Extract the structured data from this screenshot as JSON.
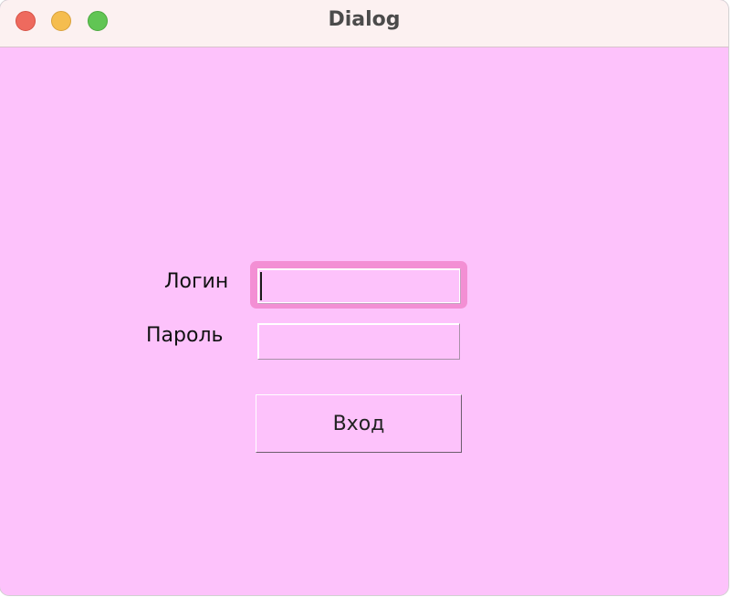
{
  "window": {
    "title": "Dialog",
    "background": "#fdc2fb",
    "titlebar_background": "#fcf1f1",
    "focus_ring_color": "#f38fd4"
  },
  "traffic_lights": {
    "close": "#ee6a5e",
    "minimize": "#f5bd4f",
    "zoom": "#61c554"
  },
  "form": {
    "login_label": "Логин",
    "login_value": "",
    "password_label": "Пароль",
    "password_value": "",
    "submit_label": "Вход"
  }
}
